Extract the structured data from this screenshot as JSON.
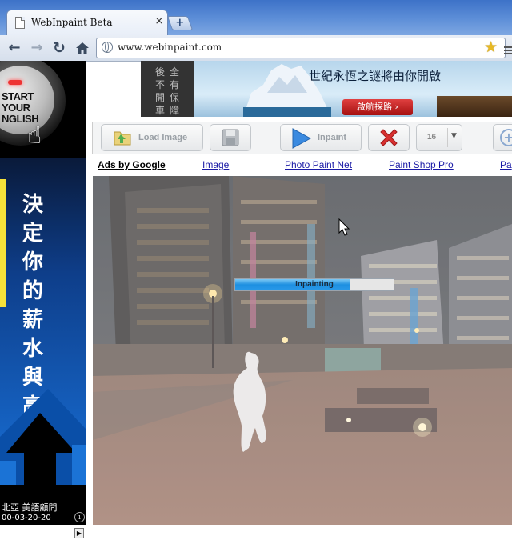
{
  "browser": {
    "tab_title": "WebInpaint Beta",
    "tab_close": "×",
    "new_tab": "+",
    "url": "www.webinpaint.com"
  },
  "nav": {
    "back": "←",
    "forward": "→",
    "reload": "↻"
  },
  "left_ad": {
    "start_text": "START\nYOUR\nNGLISH",
    "headline": "決定你的薪水與高度",
    "company": "北亞 美語顧問",
    "phone": "00-03-20-20",
    "info": "i",
    "scroll": "▶"
  },
  "top_banner": {
    "vertical_left": "後不開車",
    "vertical_right": "全有保障",
    "title": "世紀永恆之謎將由你開啟",
    "cta": "啟航探路 ›"
  },
  "app_toolbar": {
    "load_label": "Load Image",
    "inpaint_label": "Inpaint",
    "size_value": "16",
    "size_caret": "▼",
    "zoom_symbol": "+"
  },
  "ad_links": {
    "ads_by_google": "Ads by Google",
    "link1": "Image",
    "link2": "Photo Paint Net",
    "link3": "Paint Shop Pro",
    "link4": "Pa"
  },
  "progress": {
    "label": "Inpainting",
    "fraction": 0.72
  },
  "colors": {
    "chrome_blue": "#3d72c8",
    "progress_blue": "#1d8fe0",
    "link_blue": "#1a1aa6",
    "clear_red": "#d83030"
  }
}
